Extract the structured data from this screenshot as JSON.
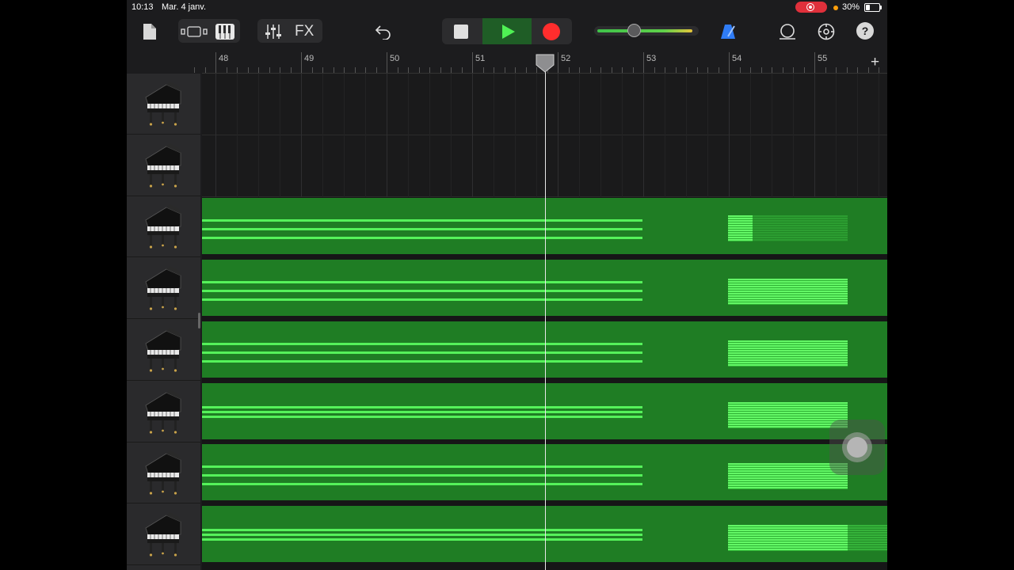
{
  "status_bar": {
    "time": "10:13",
    "date": "Mar. 4 janv.",
    "battery_percent": "30%",
    "battery_level": 0.3,
    "screen_recording": true
  },
  "toolbar": {
    "icons": [
      "my-songs-icon",
      "tracks-view-icon",
      "keyboard-icon",
      "mixer-icon",
      "undo-icon",
      "stop-icon",
      "play-icon",
      "record-icon",
      "metronome-icon",
      "loop-browser-icon",
      "settings-icon",
      "help-icon"
    ],
    "fx_label": "FX",
    "help_glyph": "?",
    "playing": true,
    "master_volume": 0.38
  },
  "ruler": {
    "bars": [
      "48",
      "49",
      "50",
      "51",
      "52",
      "53",
      "54",
      "55"
    ],
    "add_glyph": "+"
  },
  "tracks": [
    {
      "instrument": "grand-piano",
      "has_region": false
    },
    {
      "instrument": "grand-piano",
      "has_region": false
    },
    {
      "instrument": "grand-piano",
      "has_region": true
    },
    {
      "instrument": "grand-piano",
      "has_region": true
    },
    {
      "instrument": "grand-piano",
      "has_region": true
    },
    {
      "instrument": "grand-piano",
      "has_region": true
    },
    {
      "instrument": "grand-piano",
      "has_region": true
    },
    {
      "instrument": "grand-piano",
      "has_region": true
    }
  ],
  "colors": {
    "region": "#1f7d24",
    "note": "#55f25a",
    "record": "#e0303b",
    "accent_blue": "#2f7cf6"
  }
}
